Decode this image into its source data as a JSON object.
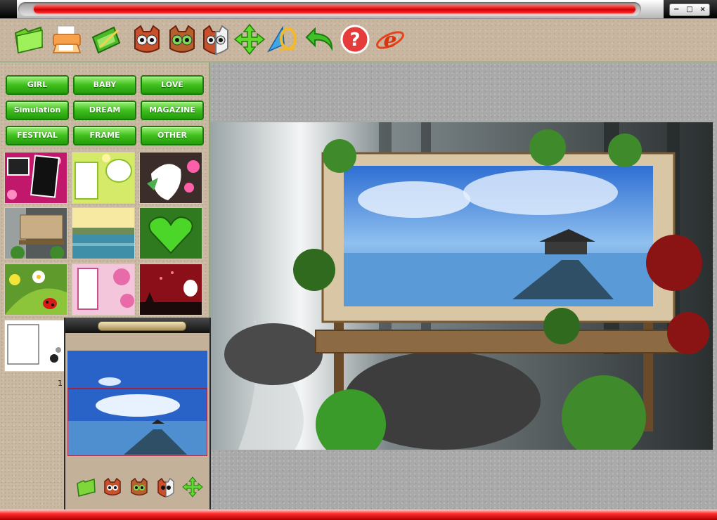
{
  "window": {
    "minimize_label": "−",
    "restore_label": "□",
    "close_label": "×"
  },
  "toolbar": {
    "buttons": [
      {
        "icon": "folder-icon"
      },
      {
        "icon": "printer-icon"
      },
      {
        "icon": "edit-photo-icon"
      },
      {
        "icon": "owl-face-icon"
      },
      {
        "icon": "owl-face-green-icon"
      },
      {
        "icon": "owl-face-half-icon"
      },
      {
        "icon": "move-arrows-icon"
      },
      {
        "icon": "rotate-icon"
      },
      {
        "icon": "undo-icon"
      },
      {
        "icon": "help-icon"
      },
      {
        "icon": "internet-explorer-icon"
      }
    ],
    "help_glyph": "?",
    "ie_glyph": "e"
  },
  "categories": {
    "row1": [
      "GIRL",
      "BABY",
      "LOVE"
    ],
    "row2": [
      "Simulation",
      "DREAM",
      "MAGAZINE"
    ],
    "row3": [
      "FESTIVAL",
      "FRAME",
      "OTHER"
    ]
  },
  "thumbnails": [
    {
      "icon": "pink-photo-frame-thumbnail"
    },
    {
      "icon": "green-floral-frame-thumbnail"
    },
    {
      "icon": "pink-flower-frame-thumbnail"
    },
    {
      "icon": "forest-billboard-thumbnail"
    },
    {
      "icon": "sunset-lake-thumbnail"
    },
    {
      "icon": "green-heart-thumbnail"
    },
    {
      "icon": "ladybug-flower-thumbnail"
    },
    {
      "icon": "pink-blossom-frame-thumbnail"
    },
    {
      "icon": "red-night-scene-thumbnail"
    },
    {
      "icon": "white-sketch-frame-thumbnail"
    }
  ],
  "pagination": {
    "page": "1"
  },
  "colors": {
    "accent_green": "#3fbf1c",
    "title_red": "#d30000",
    "panel_tan": "#c9b8a2",
    "workspace_gray": "#a9a9a9"
  }
}
